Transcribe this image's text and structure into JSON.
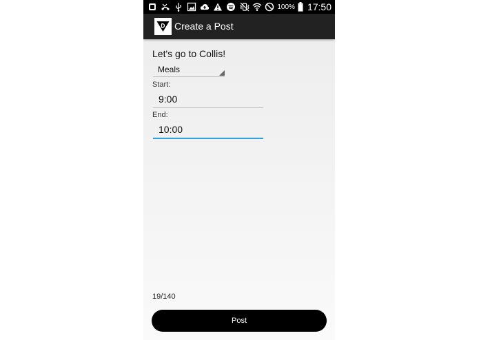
{
  "status_bar": {
    "icons_left": [
      "notification-icon",
      "missed-call-icon",
      "usb-icon",
      "image-icon",
      "cloud-upload-icon",
      "warning-icon",
      "spotify-icon"
    ],
    "icons_right": [
      "vibrate-icon",
      "wifi-icon",
      "do-not-disturb-icon",
      "battery-icon"
    ],
    "battery": "100%",
    "time": "17:50"
  },
  "app_bar": {
    "title": "Create a Post",
    "logo": "app-logo-icon"
  },
  "form": {
    "post_text": "Let's go to Collis!",
    "category": "Meals",
    "start_label": "Start:",
    "start_value": "9:00",
    "end_label": "End:",
    "end_value": "10:00",
    "char_count": "19/140",
    "post_button": "Post"
  },
  "colors": {
    "status_bar": "#000000",
    "action_bar": "#222222",
    "accent": "#33a0e0",
    "button": "#000000"
  }
}
